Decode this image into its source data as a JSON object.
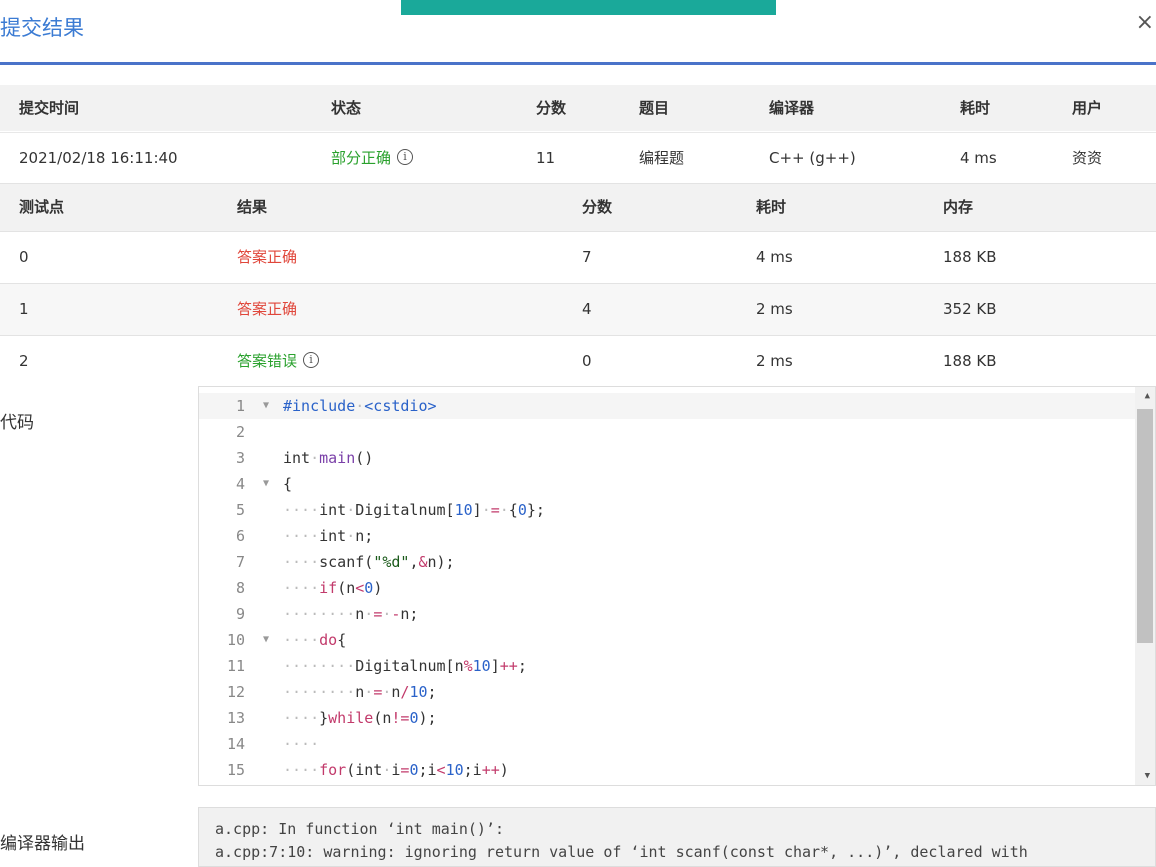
{
  "dialog": {
    "title": "提交结果",
    "close_label": "×"
  },
  "submission": {
    "headers": [
      "提交时间",
      "状态",
      "分数",
      "题目",
      "编译器",
      "耗时",
      "用户"
    ],
    "row": {
      "time": "2021/02/18 16:11:40",
      "status": "部分正确",
      "score": "11",
      "problem": "编程题",
      "compiler": "C++ (g++)",
      "elapsed": "4 ms",
      "user": "资资"
    }
  },
  "testcases": {
    "headers": [
      "测试点",
      "结果",
      "分数",
      "耗时",
      "内存"
    ],
    "rows": [
      {
        "id": "0",
        "result": "答案正确",
        "score": "7",
        "time": "4 ms",
        "memory": "188 KB"
      },
      {
        "id": "1",
        "result": "答案正确",
        "score": "4",
        "time": "2 ms",
        "memory": "352 KB"
      },
      {
        "id": "2",
        "result": "答案错误",
        "score": "0",
        "time": "2 ms",
        "memory": "188 KB"
      }
    ]
  },
  "code": {
    "label": "代码",
    "line_numbers": [
      "1",
      "2",
      "3",
      "4",
      "5",
      "6",
      "7",
      "8",
      "9",
      "10",
      "11",
      "12",
      "13",
      "14",
      "15"
    ]
  },
  "compiler_output": {
    "label": "编译器输出",
    "lines": [
      "a.cpp: In function ‘int main()’:",
      "a.cpp:7:10: warning: ignoring return value of ‘int scanf(const char*, ...)’, declared with"
    ]
  },
  "colors": {
    "accent": "#1aa99a",
    "title": "#3b7bd3",
    "correct": "#e0463a",
    "partial": "#2aa12d"
  }
}
